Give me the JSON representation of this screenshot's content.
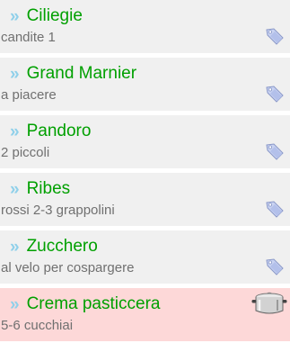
{
  "colors": {
    "item_background": "#f0f0f0",
    "item_highlight_background": "#fdd8d8",
    "title_color": "#00a000",
    "subtitle_color": "#707070",
    "chevron_color": "#8fd0ea"
  },
  "chevron": "»",
  "items": [
    {
      "title": "Ciliegie",
      "subtitle": "candite 1",
      "icon": "price-tag-icon"
    },
    {
      "title": "Grand Marnier",
      "subtitle": "a piacere",
      "icon": "price-tag-icon"
    },
    {
      "title": "Pandoro",
      "subtitle": "2 piccoli",
      "icon": "price-tag-icon"
    },
    {
      "title": "Ribes",
      "subtitle": "rossi 2-3 grappolini",
      "icon": "price-tag-icon"
    },
    {
      "title": "Zucchero",
      "subtitle": "al velo per cospargere",
      "icon": "price-tag-icon"
    },
    {
      "title": "Crema pasticcera",
      "subtitle": "5-6 cucchiai",
      "icon": "cooking-pot-icon"
    }
  ]
}
